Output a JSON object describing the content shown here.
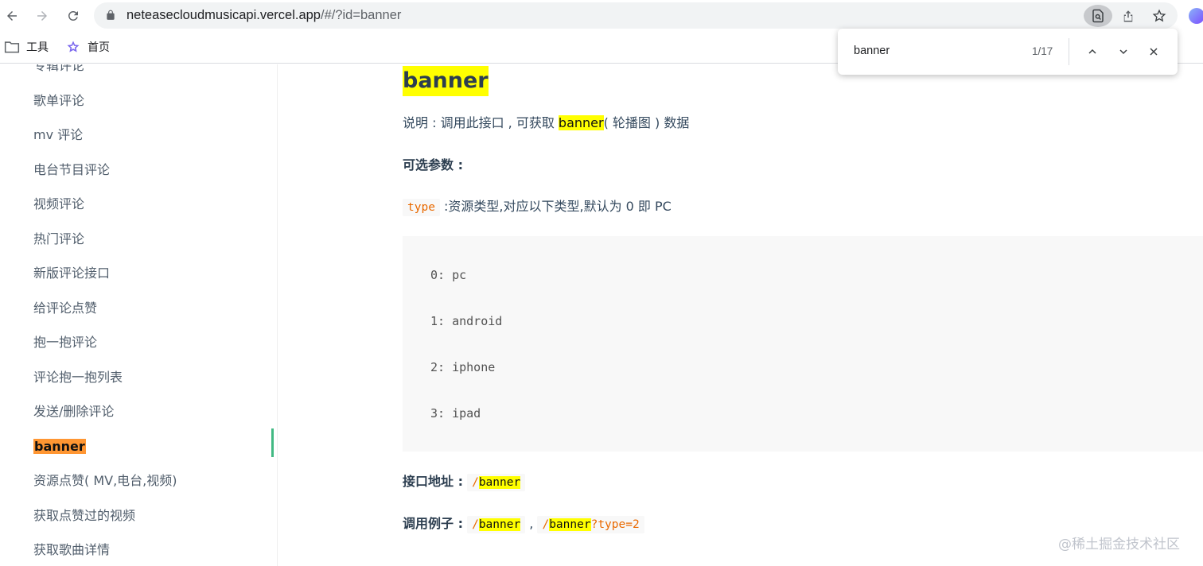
{
  "browser": {
    "url_host": "neteasecloudmusicapi.vercel.app",
    "url_path": "/#/?id=banner",
    "bookmarks": [
      {
        "label": "工具",
        "icon": "folder-icon"
      },
      {
        "label": "首页",
        "icon": "star-icon"
      }
    ]
  },
  "find_bar": {
    "query": "banner",
    "count": "1/17"
  },
  "sidebar": {
    "items": [
      {
        "label": "专辑评论"
      },
      {
        "label": "歌单评论"
      },
      {
        "label": "mv 评论"
      },
      {
        "label": "电台节目评论"
      },
      {
        "label": "视频评论"
      },
      {
        "label": "热门评论"
      },
      {
        "label": "新版评论接口"
      },
      {
        "label": "给评论点赞"
      },
      {
        "label": "抱一抱评论"
      },
      {
        "label": "评论抱一抱列表"
      },
      {
        "label": "发送/删除评论"
      },
      {
        "label": "banner",
        "active": true
      },
      {
        "label": "资源点赞( MV,电台,视频)"
      },
      {
        "label": "获取点赞过的视频"
      },
      {
        "label": "获取歌曲详情"
      }
    ]
  },
  "content": {
    "title": "banner",
    "desc_prefix": "说明 : 调用此接口 , 可获取 ",
    "desc_mark": "banner",
    "desc_suffix": "( 轮播图 ) 数据",
    "optional_params_label": "可选参数 :",
    "param_name": "type",
    "param_desc": " :资源类型,对应以下类型,默认为 0 即 PC",
    "code_lines": [
      "0: pc",
      "1: android",
      "2: iphone",
      "3: ipad"
    ],
    "endpoint_label": "接口地址 :",
    "endpoint_slash": "/",
    "endpoint_mark": "banner",
    "example_label": "调用例子 :",
    "example1_slash": "/",
    "example1_mark": "banner",
    "example_sep": " , ",
    "example2_slash": "/",
    "example2_mark": "banner",
    "example2_suffix": "?type=2"
  },
  "watermark": "@稀土掘金技术社区"
}
